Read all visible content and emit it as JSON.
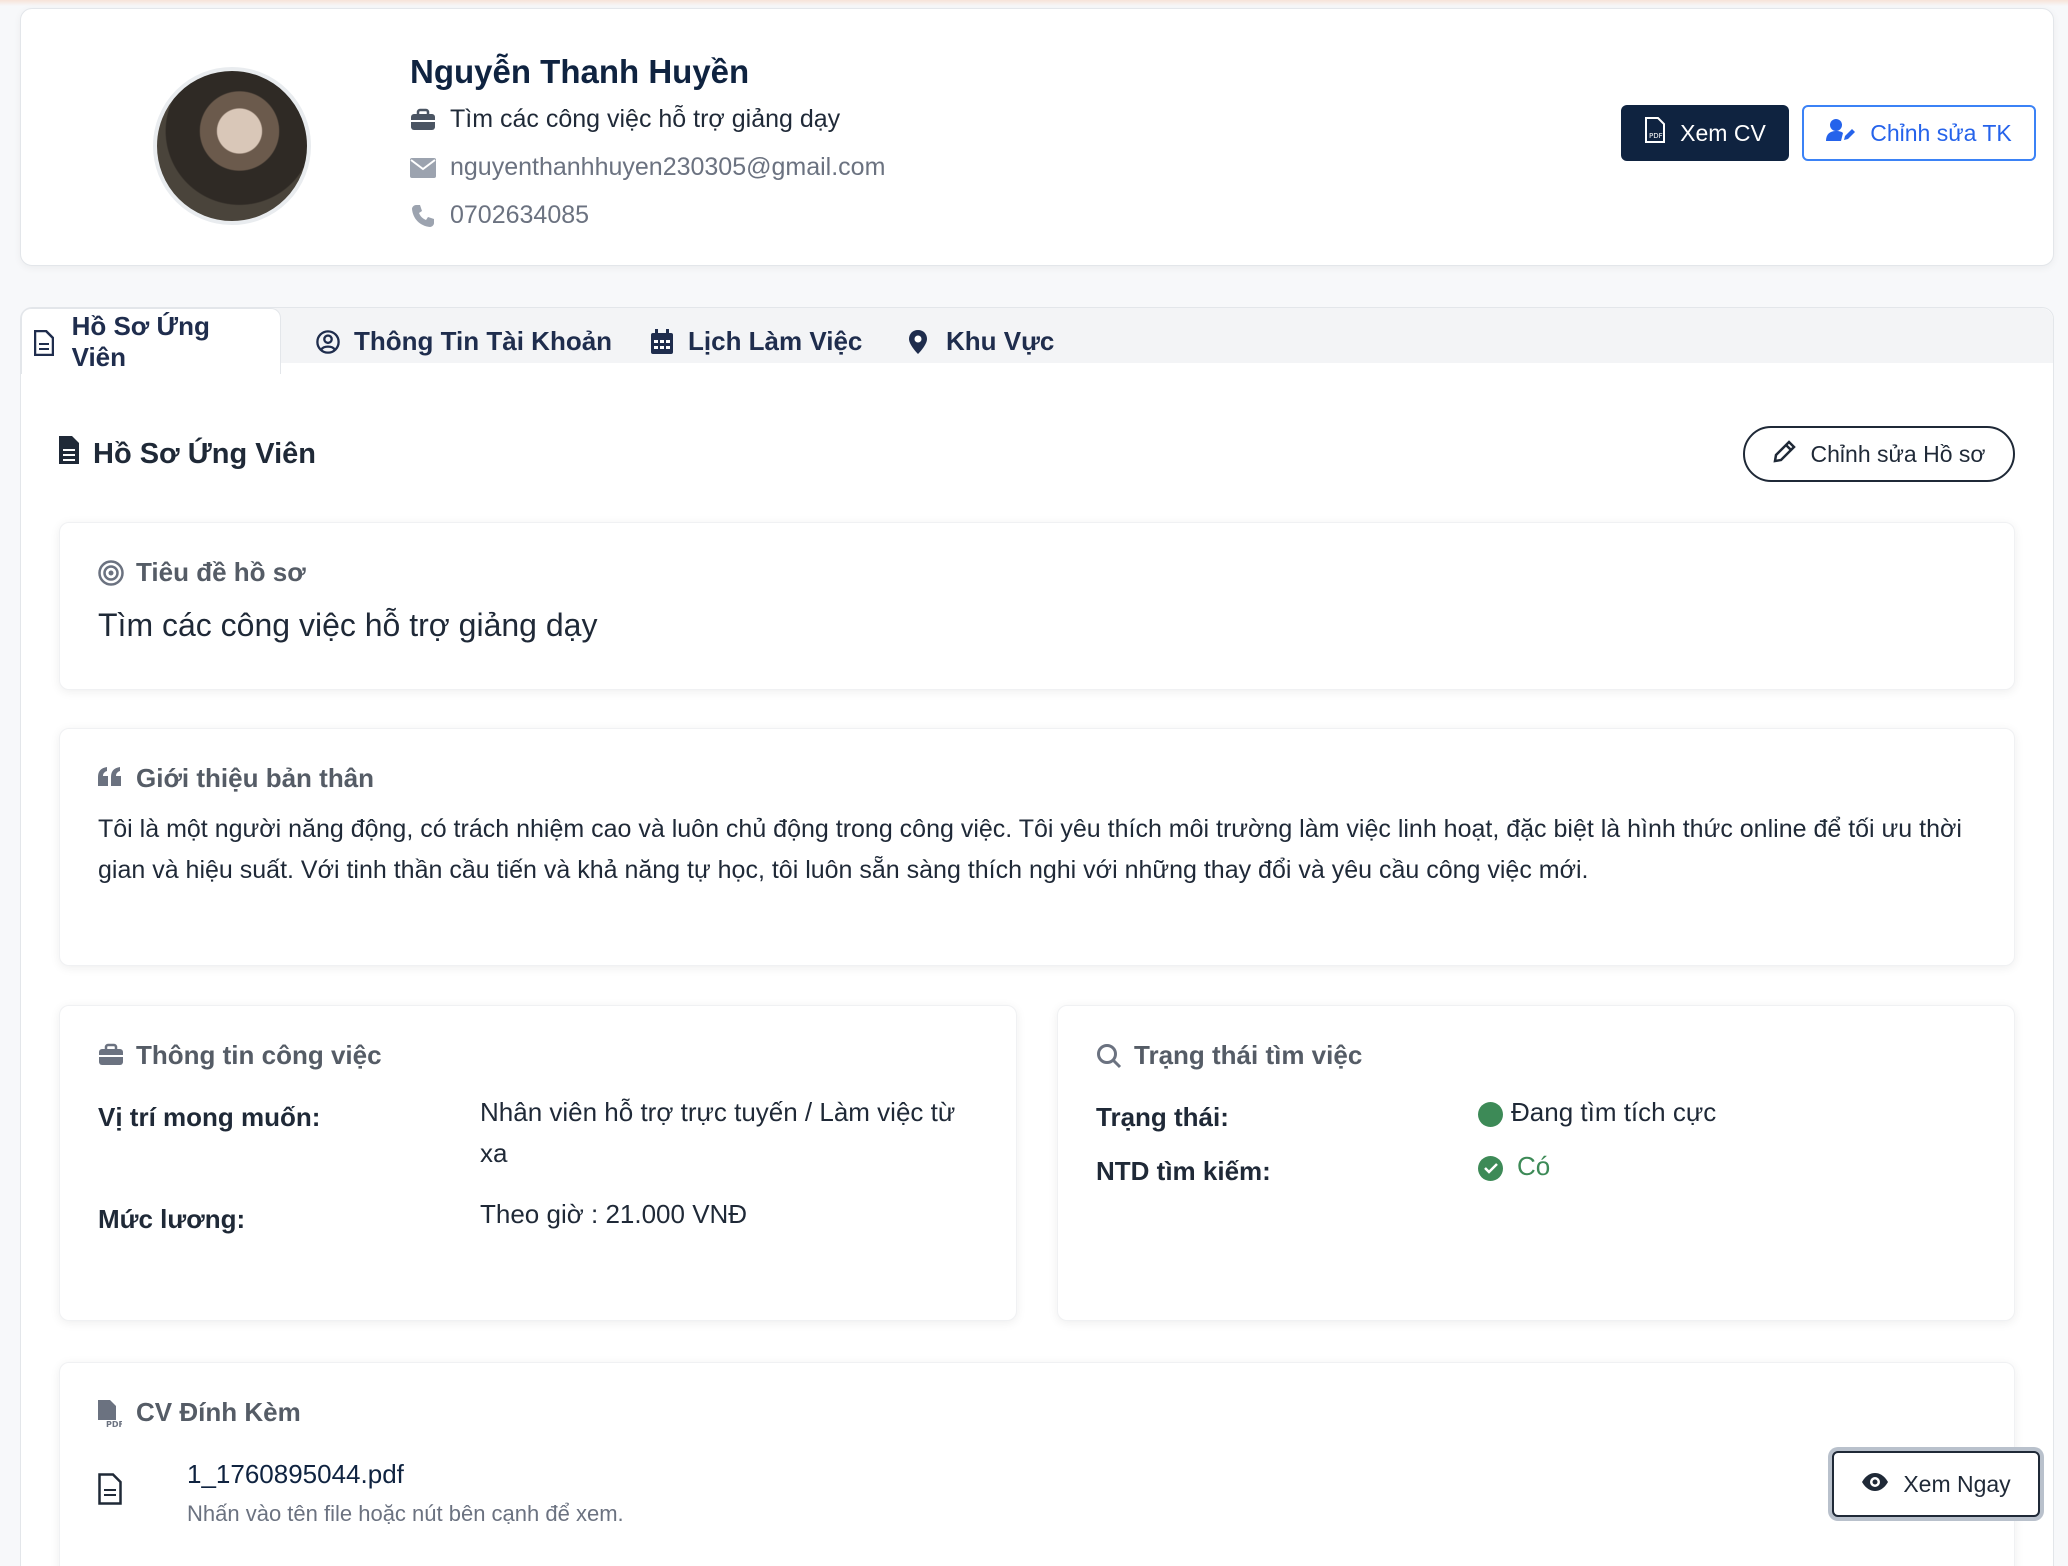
{
  "profile": {
    "name": "Nguyễn Thanh Huyền",
    "job_title": "Tìm các công việc hỗ trợ giảng dạy",
    "email": "nguyenthanhhuyen230305@gmail.com",
    "phone": "0702634085",
    "view_cv_label": "Xem CV",
    "edit_account_label": "Chỉnh sửa TK"
  },
  "tabs": [
    {
      "label": "Hồ Sơ Ứng Viên",
      "icon": "file-icon",
      "active": true
    },
    {
      "label": "Thông Tin Tài Khoản",
      "icon": "user-circle-icon",
      "active": false
    },
    {
      "label": "Lịch Làm Việc",
      "icon": "calendar-icon",
      "active": false
    },
    {
      "label": "Khu Vực",
      "icon": "map-pin-icon",
      "active": false
    }
  ],
  "section": {
    "title": "Hồ Sơ Ứng Viên",
    "edit_label": "Chỉnh sửa Hồ sơ"
  },
  "profile_title_card": {
    "heading": "Tiêu đề hồ sơ",
    "value": "Tìm các công việc hỗ trợ giảng dạy"
  },
  "bio_card": {
    "heading": "Giới thiệu bản thân",
    "text": "Tôi là một người năng động, có trách nhiệm cao và luôn chủ động trong công việc. Tôi yêu thích môi trường làm việc linh hoạt, đặc biệt là hình thức online để tối ưu thời gian và hiệu suất. Với tinh thần cầu tiến và khả năng tự học, tôi luôn sẵn sàng thích nghi với những thay đổi và yêu cầu công việc mới."
  },
  "job_info": {
    "heading": "Thông tin công việc",
    "position_label": "Vị trí mong muốn:",
    "position_value": "Nhân viên hỗ trợ trực tuyến / Làm việc từ xa",
    "salary_label": "Mức lương:",
    "salary_value": "Theo giờ : 21.000 VNĐ"
  },
  "job_status": {
    "heading": "Trạng thái tìm việc",
    "status_label": "Trạng thái:",
    "status_value": "Đang tìm tích cực",
    "employer_search_label": "NTD tìm kiếm:",
    "employer_search_value": "Có",
    "status_color": "#3d8a57"
  },
  "cv_attachment": {
    "heading": "CV Đính Kèm",
    "file_name": "1_1760895044.pdf",
    "hint": "Nhấn vào tên file hoặc nút bên cạnh để xem.",
    "view_now_label": "Xem Ngay"
  },
  "colors": {
    "navy": "#0f2340",
    "blue": "#2563eb",
    "green": "#3d8a57"
  }
}
